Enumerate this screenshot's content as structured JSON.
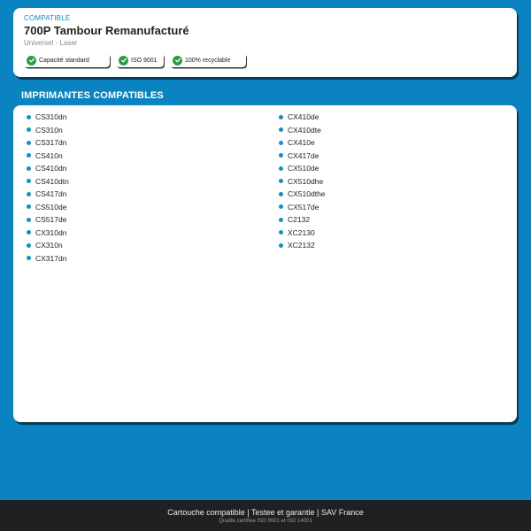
{
  "header": {
    "eyebrow": "COMPATIBLE",
    "title": "700P Tambour Remanufacturé",
    "subtitle": "Universel - Laser",
    "badges": [
      {
        "label": "Capacité standard",
        "icon": "check-circle-icon"
      },
      {
        "label": "ISO 9001",
        "icon": "check-circle-icon"
      },
      {
        "label": "100% recyclable",
        "icon": "check-circle-icon"
      }
    ]
  },
  "printers": {
    "section_title": "IMPRIMANTES COMPATIBLES",
    "left": [
      "CS310dn",
      "CS310n",
      "CS317dn",
      "CS410n",
      "CS410dn",
      "CS410dtn",
      "CS417dn",
      "CS510de",
      "CS517de",
      "CX310dn",
      "CX310n",
      "CX317dn"
    ],
    "right": [
      "CX410de",
      "CX410dte",
      "CX410e",
      "CX417de",
      "CX510de",
      "CX510dhe",
      "CX510dthe",
      "CX517de",
      "C2132",
      "XC2130",
      "XC2132"
    ]
  },
  "footer": {
    "main": "Cartouche compatible  |  Testee et garantie  |  SAV France",
    "sub": "Qualite certifiee ISO 9001 et ISO 14001"
  },
  "colors": {
    "background": "#0a83c0",
    "accent": "#1a8cc4",
    "check": "#2a9d46",
    "footer": "#1f2022"
  }
}
